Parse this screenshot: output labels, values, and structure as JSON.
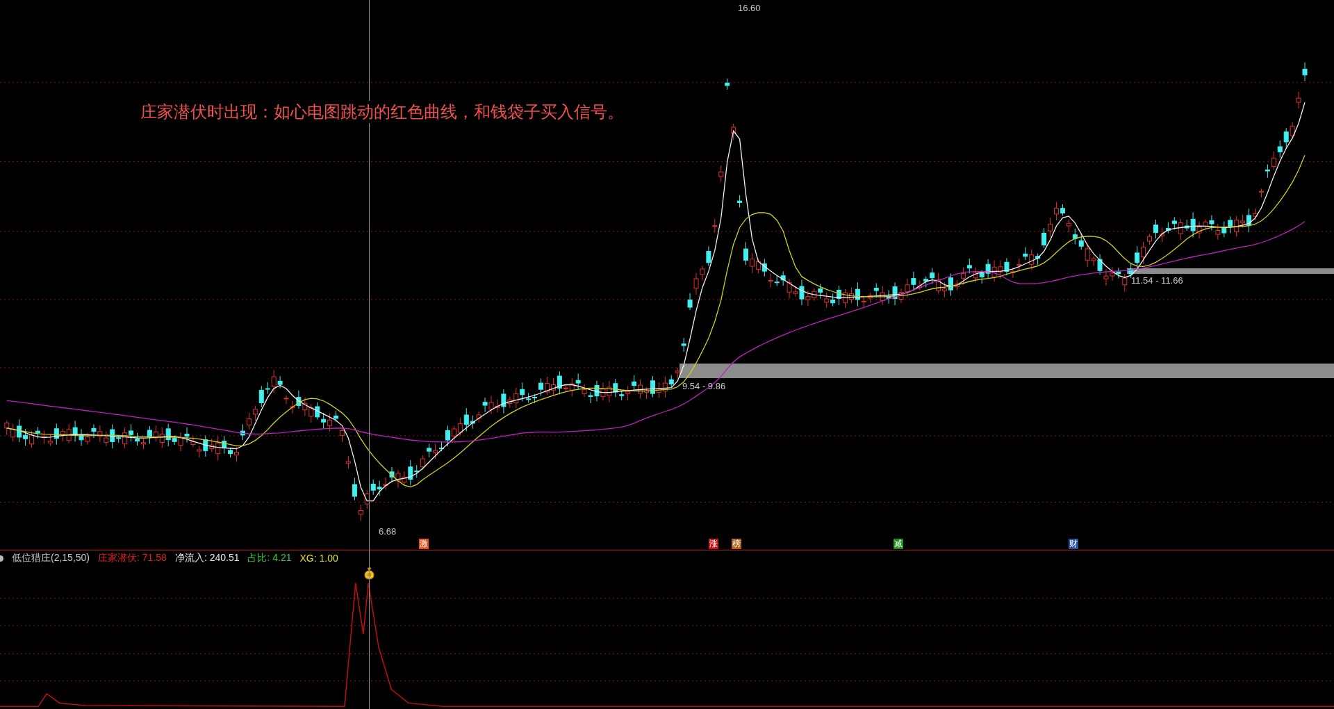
{
  "annotation": "庄家潜伏时出现：如心电图跳动的红色曲线，和钱袋子买入信号。",
  "price_labels": [
    {
      "kind": "high",
      "text": "16.60"
    },
    {
      "kind": "zone",
      "text": "9.54 - 9.86"
    },
    {
      "kind": "zone",
      "text": "11.54 - 11.66"
    },
    {
      "kind": "low",
      "text": "6.68"
    }
  ],
  "signal_badges": [
    {
      "text": "激",
      "color": "#e0501a"
    },
    {
      "text": "涨",
      "color": "#c01818"
    },
    {
      "text": "榜",
      "color": "#b06018"
    },
    {
      "text": "减",
      "color": "#1c8c1c"
    },
    {
      "text": "财",
      "color": "#2850a0"
    }
  ],
  "indicator_legend": [
    {
      "text": "低位猎庄(2,15,50)",
      "color": "#c8c8c8"
    },
    {
      "text": "庄家潜伏: 71.58",
      "color": "#e02020"
    },
    {
      "text": "净流入: 240.51",
      "color": "#e8e8e8"
    },
    {
      "text": "占比: 4.21",
      "color": "#30d030"
    },
    {
      "text": "XG: 1.00",
      "color": "#e0e020"
    }
  ]
}
